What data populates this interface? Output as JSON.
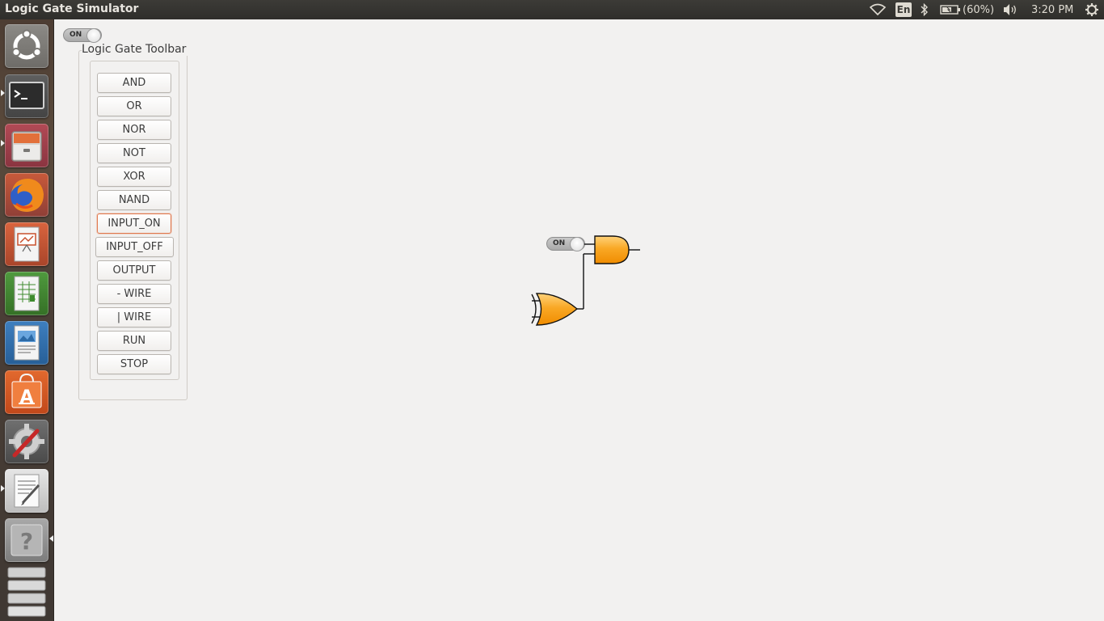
{
  "window": {
    "title": "Logic Gate Simulator"
  },
  "top_panel": {
    "language": "En",
    "battery": "(60%)",
    "clock": "3:20 PM",
    "icons": [
      "wifi-icon",
      "bluetooth-icon",
      "battery-icon",
      "volume-icon",
      "settings-gear-icon"
    ]
  },
  "launcher": {
    "items": [
      {
        "name": "ubuntu-dash",
        "icon": "ubuntu-logo-icon"
      },
      {
        "name": "terminal",
        "icon": "terminal-icon"
      },
      {
        "name": "files",
        "icon": "file-cabinet-icon"
      },
      {
        "name": "firefox",
        "icon": "firefox-icon"
      },
      {
        "name": "impress",
        "icon": "presentation-icon"
      },
      {
        "name": "calc",
        "icon": "spreadsheet-icon"
      },
      {
        "name": "writer",
        "icon": "document-icon"
      },
      {
        "name": "software-center",
        "icon": "shopping-bag-icon"
      },
      {
        "name": "system-settings",
        "icon": "wrench-gear-icon"
      },
      {
        "name": "text-editor",
        "icon": "text-editor-icon"
      },
      {
        "name": "help",
        "icon": "question-icon"
      },
      {
        "name": "workspaces",
        "icon": "workspace-stack-icon"
      }
    ]
  },
  "toggle_main": {
    "label": "ON"
  },
  "toolbar": {
    "title": "Logic Gate Toolbar",
    "buttons": [
      {
        "label": "AND"
      },
      {
        "label": "OR"
      },
      {
        "label": "NOR"
      },
      {
        "label": "NOT"
      },
      {
        "label": "XOR"
      },
      {
        "label": "NAND"
      },
      {
        "label": "INPUT_ON"
      },
      {
        "label": "INPUT_OFF"
      },
      {
        "label": "OUTPUT"
      },
      {
        "label": "- WIRE"
      },
      {
        "label": "| WIRE"
      },
      {
        "label": "RUN"
      },
      {
        "label": "STOP"
      }
    ],
    "focused_button": "INPUT_ON"
  },
  "canvas": {
    "input_toggle_label": "ON",
    "components": [
      "input-toggle",
      "and-gate",
      "xor-gate",
      "wire"
    ],
    "gate_color": "#f7a21b"
  },
  "colors": {
    "panel": "#3c3b37",
    "background": "#f2f1f0",
    "focus": "#e0784d",
    "gate_fill": "#f7a21b"
  }
}
